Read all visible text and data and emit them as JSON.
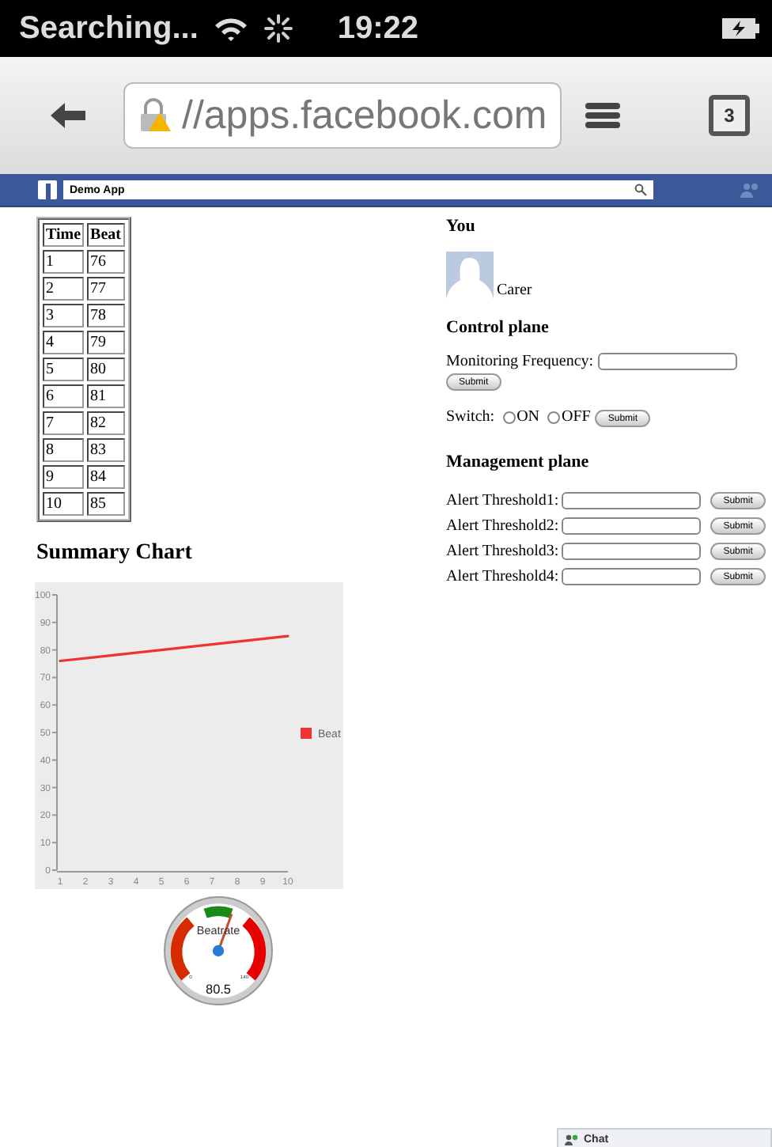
{
  "status_bar": {
    "carrier": "Searching...",
    "time": "19:22"
  },
  "browser": {
    "url": "//apps.facebook.com",
    "tab_count": "3"
  },
  "fb_bar": {
    "search_value": "Demo App"
  },
  "table": {
    "columns": [
      "Time",
      "Beat"
    ],
    "rows": [
      [
        "1",
        "76"
      ],
      [
        "2",
        "77"
      ],
      [
        "3",
        "78"
      ],
      [
        "4",
        "79"
      ],
      [
        "5",
        "80"
      ],
      [
        "6",
        "81"
      ],
      [
        "7",
        "82"
      ],
      [
        "8",
        "83"
      ],
      [
        "9",
        "84"
      ],
      [
        "10",
        "85"
      ]
    ]
  },
  "summary_title": "Summary Chart",
  "chart_data": {
    "type": "line",
    "x": [
      1,
      2,
      3,
      4,
      5,
      6,
      7,
      8,
      9,
      10
    ],
    "xticks": [
      1,
      2,
      3,
      4,
      5,
      6,
      7,
      8,
      9,
      10
    ],
    "yticks": [
      0,
      10,
      20,
      30,
      40,
      50,
      60,
      70,
      80,
      90,
      100
    ],
    "ylim": [
      0,
      100
    ],
    "xlim": [
      1,
      10
    ],
    "series": [
      {
        "name": "Beat",
        "color": "#ee3333",
        "values": [
          76,
          77,
          78,
          79,
          80,
          81,
          82,
          83,
          84,
          85
        ]
      }
    ]
  },
  "gauge": {
    "title": "Beatrate",
    "reading": "80.5",
    "min_label": "0",
    "max_label": "140"
  },
  "you": {
    "heading": "You",
    "name": "Carer"
  },
  "control": {
    "heading": "Control plane",
    "frequency_label": "Monitoring Frequency:",
    "submit": "Submit",
    "switch_label": "Switch:",
    "options": [
      {
        "label": "ON",
        "selected": false
      },
      {
        "label": "OFF",
        "selected": false
      }
    ],
    "switch_submit": "Submit"
  },
  "management": {
    "heading": "Management plane",
    "thresholds": [
      {
        "label": "Alert Threshold1:",
        "submit": "Submit"
      },
      {
        "label": "Alert Threshold2:",
        "submit": "Submit"
      },
      {
        "label": "Alert Threshold3:",
        "submit": "Submit"
      },
      {
        "label": "Alert Threshold4:",
        "submit": "Submit"
      }
    ]
  },
  "chat": {
    "label": "Chat"
  }
}
